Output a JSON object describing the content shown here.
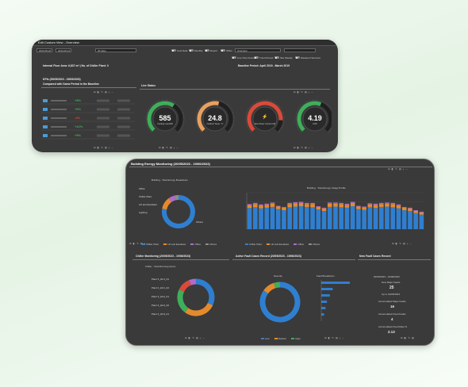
{
  "win1": {
    "title": "Edit Custom View - Overview",
    "date_from": "2023-05-20",
    "date_to": "2023-06-19",
    "period_select": "30 days",
    "toggles": [
      "Cost Data",
      "Monthly",
      "Report",
      "Office"
    ],
    "view_select": "Overview",
    "legend_toggles": [
      "Live Only Period",
      "Trend Period",
      "Site Weekly",
      "Weekend Services"
    ],
    "floor_area": "Internal Floor Area: 6,837 m² | No. of Chiller Plant: 3",
    "baseline": "Baseline Period: April 2019 - March 2019",
    "kpi_title": "KPIs (20/05/2023 - 19/06/2023)",
    "kpi_subtitle": "Compared with Same Period in the Baseline",
    "live_status": "Live Status",
    "gauges": [
      {
        "value": "585",
        "unit": "kW",
        "label": "Cooling Load",
        "color": "#3fae5b",
        "frac": 0.62
      },
      {
        "value": "24.8",
        "unit": "°C",
        "label": "Outdoor Temp.",
        "color": "#e8a060",
        "frac": 0.55
      },
      {
        "value": "",
        "unit": "",
        "label": "Site Power Current kW",
        "color": "#d94a3a",
        "frac": 0.85
      },
      {
        "value": "4.19",
        "unit": "",
        "label": "COP",
        "color": "#3fae5b",
        "frac": 0.58
      }
    ],
    "kpi_rows": [
      {
        "value": "+8%",
        "color": "#3fae5b"
      },
      {
        "value": "+6%",
        "color": "#3fae5b"
      },
      {
        "value": "-2%",
        "color": "#d94a3a"
      },
      {
        "value": "+12%",
        "color": "#3fae5b"
      },
      {
        "value": "+9%",
        "color": "#3fae5b"
      }
    ]
  },
  "win2": {
    "section_title": "Building Energy Monitoring (20/05/2023 - 19/06/2023)",
    "breakdown_title": "Building - Total Energy Breakdown",
    "daily_title": "Building - Total Energy Usage Profile",
    "donut_labels": [
      "Office",
      "Chiller Plant",
      "Lift and Escalator",
      "Lighting",
      "Others"
    ],
    "legend": [
      {
        "name": "Chiller Plant",
        "color": "#2f7fd1"
      },
      {
        "name": "Lift and Escalator",
        "color": "#e58a2c"
      },
      {
        "name": "Office",
        "color": "#b06acb"
      },
      {
        "name": "Others",
        "color": "#8c8c8c"
      }
    ],
    "chiller_title": "Chiller Monitoring (20/05/2023 - 19/06/2023)",
    "chiller_sub": "Chiller - Total Running Hours",
    "chiller_labels": [
      "Plant 3_HC1_01",
      "Plant 3_HC1_02",
      "Plant 3_HC2_01",
      "Plant 3_HC2_02",
      "Plant 3_HC3_01"
    ],
    "fault_title": "Active Fault Cases Record (20/05/2023 - 19/06/2023)",
    "severity_title": "Severity",
    "fault_breakdown_title": "Fault Breakdown",
    "fault_legend": [
      "Low",
      "Medium",
      "High"
    ],
    "new_fault_title": "New Fault Cases Record",
    "new_fault_date": "20/05/2023 - 19/06/2023",
    "new_major_label": "New Major Faults",
    "new_major_value": "25",
    "up_to_label": "Up to 19/06/2023",
    "acc_major_label": "Accumulated Major Faults",
    "acc_major_value": "16",
    "acc_fixed_label": "Accumulated Fixed Faults",
    "acc_fixed_value": "4",
    "acc_rate_label": "Accumulated Fixed Rate %",
    "acc_rate_value": "2.13"
  },
  "chart_data": [
    {
      "type": "bar",
      "title": "Building - Total Energy Usage Profile",
      "categories": [
        "1",
        "2",
        "3",
        "4",
        "5",
        "6",
        "7",
        "8",
        "9",
        "10",
        "11",
        "12",
        "13",
        "14",
        "15",
        "16",
        "17",
        "18",
        "19",
        "20",
        "21",
        "22",
        "23",
        "24",
        "25",
        "26",
        "27",
        "28",
        "29",
        "30",
        "31"
      ],
      "series": [
        {
          "name": "Chiller Plant",
          "color": "#2f7fd1",
          "values": [
            58,
            60,
            57,
            59,
            61,
            55,
            52,
            60,
            62,
            63,
            61,
            60,
            54,
            50,
            61,
            62,
            60,
            59,
            63,
            55,
            53,
            60,
            58,
            61,
            62,
            60,
            57,
            52,
            50,
            44,
            40
          ]
        },
        {
          "name": "Lift and Escalator",
          "color": "#e58a2c",
          "values": [
            8,
            9,
            8,
            8,
            9,
            7,
            7,
            9,
            9,
            9,
            8,
            9,
            7,
            7,
            9,
            8,
            9,
            8,
            9,
            7,
            7,
            8,
            9,
            8,
            8,
            9,
            8,
            7,
            7,
            6,
            6
          ]
        },
        {
          "name": "Office",
          "color": "#b06acb",
          "values": [
            3,
            3,
            3,
            3,
            3,
            2,
            2,
            3,
            3,
            3,
            3,
            3,
            2,
            2,
            3,
            3,
            3,
            3,
            3,
            2,
            2,
            3,
            3,
            3,
            3,
            3,
            3,
            2,
            2,
            2,
            2
          ]
        }
      ],
      "ylim": [
        0,
        100
      ]
    },
    {
      "type": "pie",
      "title": "Building - Total Energy Breakdown",
      "slices": [
        {
          "name": "Chiller Plant",
          "value": 78,
          "color": "#2f7fd1"
        },
        {
          "name": "Lift and Escalator",
          "value": 12,
          "color": "#e58a2c"
        },
        {
          "name": "Office",
          "value": 6,
          "color": "#b06acb"
        },
        {
          "name": "Others",
          "value": 4,
          "color": "#8c8c8c"
        }
      ]
    },
    {
      "type": "pie",
      "title": "Chiller - Total Running Hours",
      "slices": [
        {
          "name": "Plant 3_HC1_01",
          "value": 32,
          "color": "#2f7fd1"
        },
        {
          "name": "Plant 3_HC1_02",
          "value": 28,
          "color": "#e58a2c"
        },
        {
          "name": "Plant 3_HC2_01",
          "value": 22,
          "color": "#3fae5b"
        },
        {
          "name": "Plant 3_HC2_02",
          "value": 12,
          "color": "#d94a3a"
        },
        {
          "name": "Plant 3_HC3_01",
          "value": 6,
          "color": "#b06acb"
        }
      ]
    },
    {
      "type": "pie",
      "title": "Severity",
      "slices": [
        {
          "name": "Low",
          "value": 85,
          "color": "#2f7fd1"
        },
        {
          "name": "Medium",
          "value": 10,
          "color": "#e58a2c"
        },
        {
          "name": "High",
          "value": 5,
          "color": "#3fae5b"
        }
      ]
    },
    {
      "type": "bar",
      "title": "Fault Breakdown",
      "categories": [
        "a",
        "b",
        "c",
        "d",
        "e",
        "f"
      ],
      "values": [
        20,
        8,
        6,
        4,
        3,
        2
      ],
      "orientation": "horizontal"
    }
  ]
}
